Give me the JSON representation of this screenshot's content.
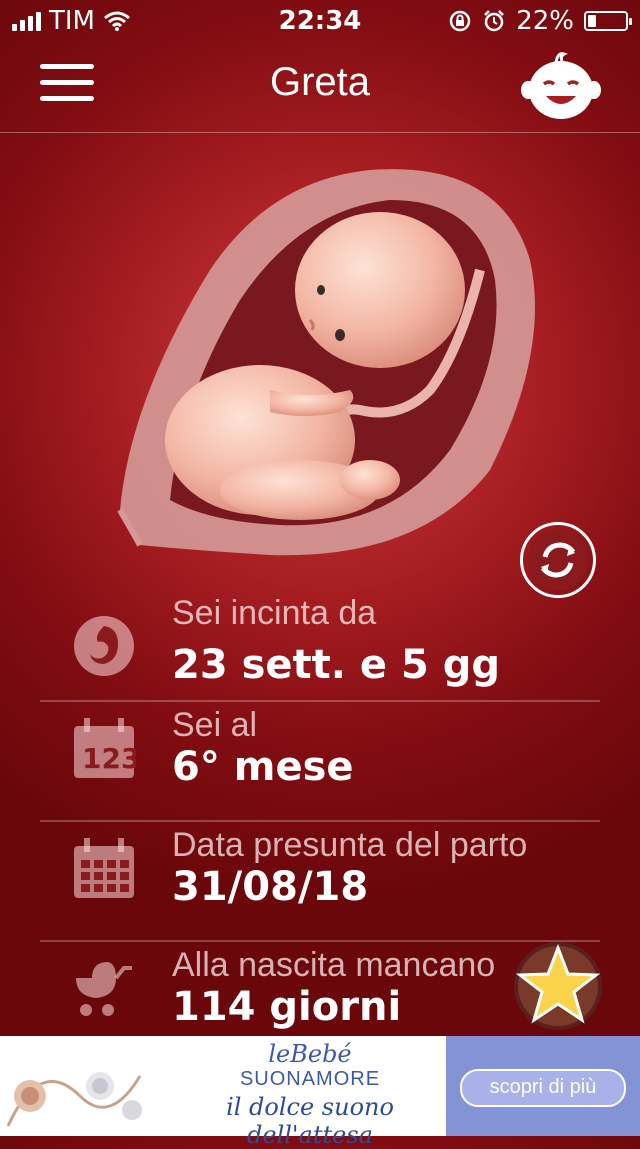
{
  "status_bar": {
    "carrier": "TIM",
    "time": "22:34",
    "battery": "22%"
  },
  "nav": {
    "title": "Greta",
    "menu_icon": "hamburger-menu-icon",
    "profile_icon": "baby-face-icon"
  },
  "info_rows": [
    {
      "label": "Sei incinta da",
      "value": "23 sett. e 5 gg",
      "icon": "fetus-icon"
    },
    {
      "label": "Sei al",
      "value": "6° mese",
      "icon": "calendar-123-icon"
    },
    {
      "label": "Data presunta del parto",
      "value": "31/08/18",
      "icon": "calendar-grid-icon"
    },
    {
      "label": "Alla nascita mancano",
      "value": "114 giorni",
      "icon": "stroller-icon"
    }
  ],
  "banner": {
    "brand_line1": "leBebé",
    "brand_line2": "SUONAMORE",
    "tagline": "il dolce suono dell'attesa",
    "cta_label": "scopri di più"
  },
  "colors": {
    "background": "#a81e22",
    "banner_cta": "#8492d6",
    "brand_text": "#3c5aa8"
  }
}
